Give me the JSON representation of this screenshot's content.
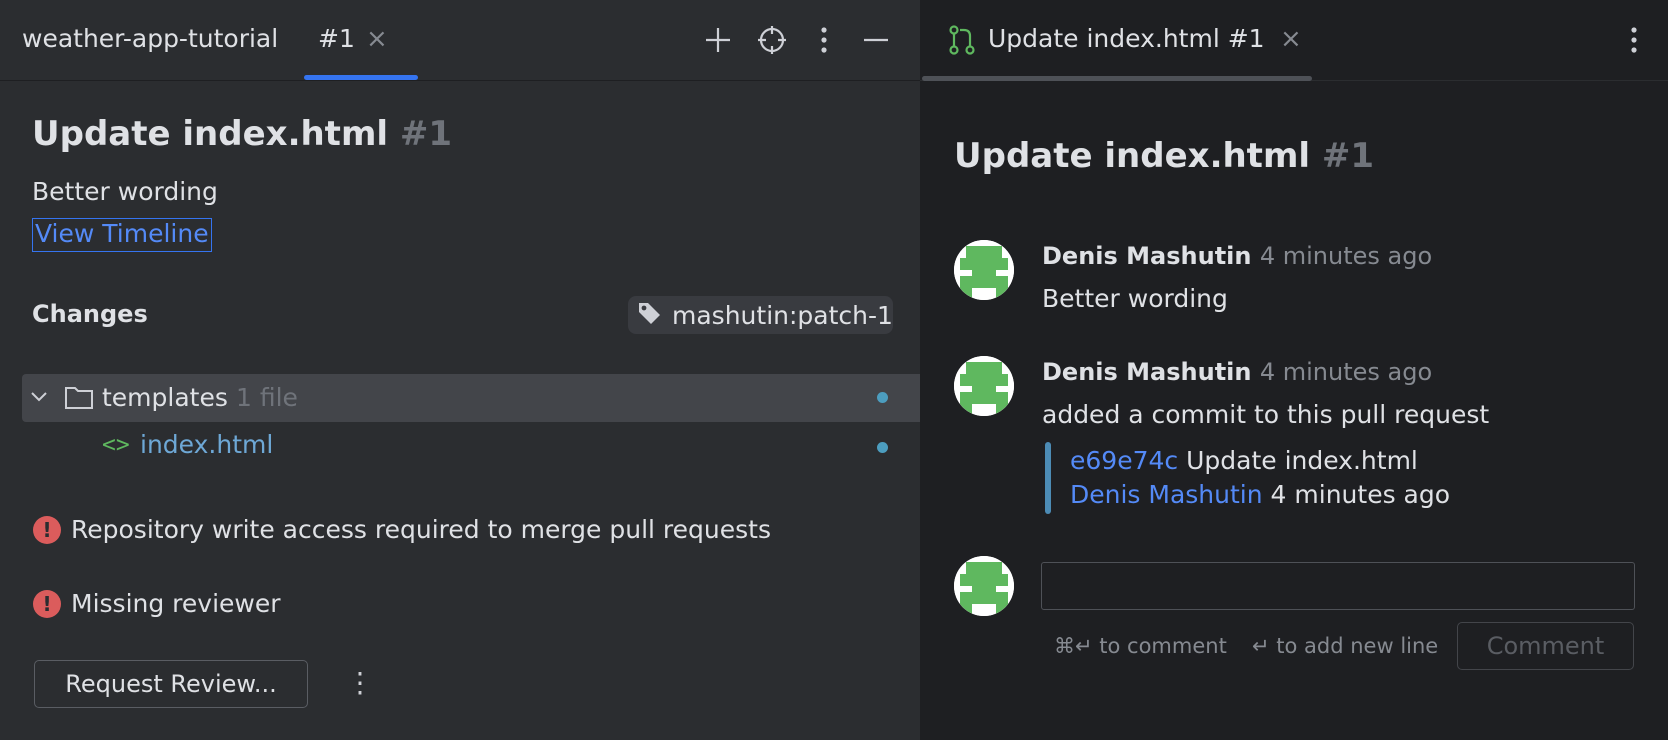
{
  "left_tabs": {
    "project": "weather-app-tutorial",
    "active_tab": "#1"
  },
  "left_toolbar": {
    "icons": [
      "plus-icon",
      "crosshair-icon",
      "more-vertical-icon",
      "minimize-icon"
    ]
  },
  "pr": {
    "title": "Update index.html",
    "number": "#1",
    "description": "Better wording",
    "view_timeline": "View Timeline"
  },
  "changes": {
    "label": "Changes",
    "branch": "mashutin:patch-1",
    "folder": {
      "name": "templates",
      "count": "1 file"
    },
    "file": {
      "icon_text": "<>",
      "name": "index.html"
    }
  },
  "errors": [
    "Repository write access required to merge pull requests",
    "Missing reviewer"
  ],
  "actions": {
    "request_review": "Request Review...",
    "more": "⋮"
  },
  "right_tab": {
    "title": "Update index.html #1"
  },
  "timeline": {
    "title": "Update index.html",
    "number": "#1",
    "items": [
      {
        "author": "Denis Mashutin",
        "time": "4 minutes ago",
        "text": "Better wording"
      },
      {
        "author": "Denis Mashutin",
        "time": "4 minutes ago",
        "text": "added a commit to this pull request",
        "commit": {
          "hash": "e69e74c",
          "message": "Update index.html",
          "author": "Denis Mashutin",
          "time": "4 minutes ago"
        }
      }
    ]
  },
  "comment_box": {
    "value": "",
    "hint_submit": "⌘↵ to comment",
    "hint_newline": "↵ to add new line",
    "button": "Comment"
  },
  "colors": {
    "accent": "#3574f0",
    "link": "#548af7",
    "error": "#db5c5c",
    "avatar_green": "#5fb85f",
    "change_dot": "#4c9dbf"
  }
}
